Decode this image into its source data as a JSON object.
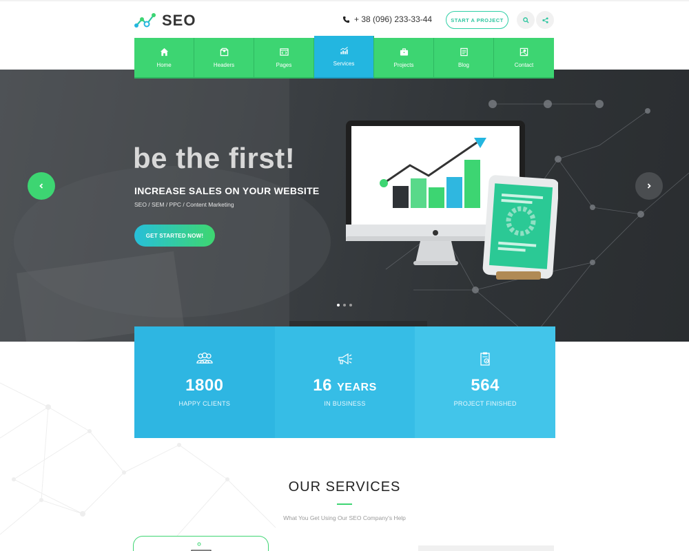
{
  "header": {
    "logo_text": "SEO",
    "phone": "+ 38 (096) 233-33-44",
    "cta_label": "START A PROJECT",
    "search_icon": "search-icon",
    "share_icon": "share-icon"
  },
  "nav": {
    "items": [
      {
        "label": "Home",
        "icon": "home-icon"
      },
      {
        "label": "Headers",
        "icon": "box-icon"
      },
      {
        "label": "Pages",
        "icon": "code-window-icon"
      },
      {
        "label": "Services",
        "icon": "chart-icon",
        "active": true
      },
      {
        "label": "Projects",
        "icon": "briefcase-icon"
      },
      {
        "label": "Blog",
        "icon": "document-icon"
      },
      {
        "label": "Contact",
        "icon": "map-icon"
      }
    ]
  },
  "hero": {
    "headline": "be the first!",
    "subhead": "INCREASE SALES ON YOUR WEBSITE",
    "tagline": "SEO / SEM / PPC / Content Marketing",
    "button_label": "GET STARTED NOW!",
    "slide_count": 3,
    "active_slide": 1
  },
  "stats": [
    {
      "number": "1800",
      "unit": "",
      "label": "HAPPY CLIENTS",
      "icon": "users-icon"
    },
    {
      "number": "16",
      "unit": "YEARS",
      "label": "IN BUSINESS",
      "icon": "megaphone-icon"
    },
    {
      "number": "564",
      "unit": "",
      "label": "PROJECT FINISHED",
      "icon": "clipboard-icon"
    }
  ],
  "services": {
    "title": "OUR SERVICES",
    "subtitle": "What You Get Using Our SEO Company's Help"
  },
  "colors": {
    "green": "#3dd572",
    "blue": "#23b6e0",
    "stat_blue": "#2eb6e2"
  }
}
